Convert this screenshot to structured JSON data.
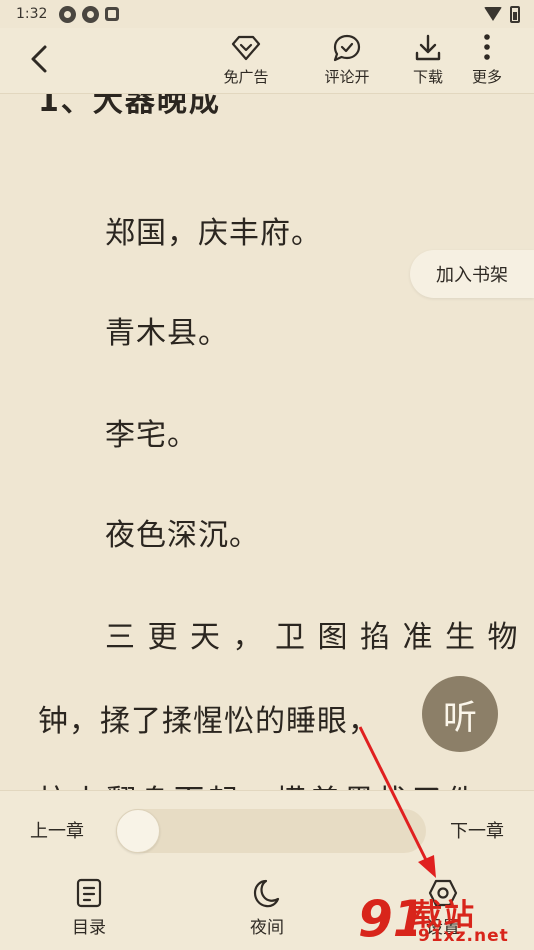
{
  "status_bar": {
    "time": "1:32",
    "left_icons": [
      "sync-icon",
      "sync-icon",
      "a-badge-icon"
    ],
    "right_icons": [
      "wifi-icon",
      "battery-icon"
    ]
  },
  "toolbar": {
    "back_icon": "chevron-left-icon",
    "items": [
      {
        "label": "免广告",
        "icon": "diamond-icon"
      },
      {
        "label": "评论开",
        "icon": "comment-icon"
      },
      {
        "label": "下载",
        "icon": "download-icon"
      },
      {
        "label": "更多",
        "icon": "more-vertical-icon"
      }
    ]
  },
  "reader": {
    "chapter_title": "1、大器晚成",
    "paragraphs": [
      "郑国，庆丰府。",
      "青木县。",
      "李宅。",
      "夜色深沉。",
      "三更天，卫图掐准生物",
      "钟，揉了揉惺忪的睡眼，",
      "炕上翻身而起，摸着黑找了件"
    ],
    "add_shelf_label": "加入书架",
    "listen_label": "听"
  },
  "bottom_panel": {
    "prev_chapter": "上一章",
    "next_chapter": "下一章",
    "progress": 0.0,
    "nav": [
      {
        "label": "目录",
        "icon": "catalog-icon"
      },
      {
        "label": "夜间",
        "icon": "moon-icon"
      },
      {
        "label": "设置",
        "icon": "settings-icon"
      }
    ]
  },
  "colors": {
    "background": "#efe6d2",
    "bar": "#f1e9d6",
    "text": "#2b2620",
    "listen_button": "#8c7f68",
    "annotation_arrow": "#e02020",
    "watermark": "#d8251b"
  },
  "watermark": {
    "logo_digits": "91",
    "brand": "载站",
    "url": "91xz.net"
  }
}
